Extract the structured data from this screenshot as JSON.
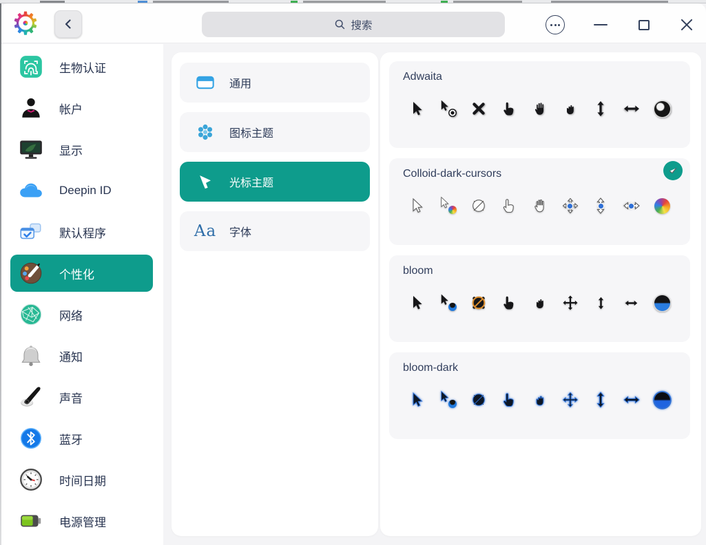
{
  "colors": {
    "accent_teal": "#0e9c8c",
    "title_text": "#313e5c",
    "card_bg": "#f6f6f8",
    "selected_text": "#ffffff"
  },
  "titlebar": {
    "search": {
      "placeholder": "搜索"
    },
    "icons": {
      "logo": "settings-gear",
      "back": "chevron-left",
      "menu": "more-options-dots",
      "minimize": "minimize",
      "maximize": "maximize",
      "close": "close"
    }
  },
  "sidebar": {
    "items": [
      {
        "label": "生物认证",
        "icon": "fingerprint",
        "selected": false
      },
      {
        "label": "帐户",
        "icon": "user-account",
        "selected": false
      },
      {
        "label": "显示",
        "icon": "display-monitor",
        "selected": false
      },
      {
        "label": "Deepin ID",
        "icon": "cloud",
        "selected": false
      },
      {
        "label": "默认程序",
        "icon": "default-apps",
        "selected": false
      },
      {
        "label": "个性化",
        "icon": "personalization-palette",
        "selected": true
      },
      {
        "label": "网络",
        "icon": "network-globe",
        "selected": false
      },
      {
        "label": "通知",
        "icon": "notification-bell",
        "selected": false
      },
      {
        "label": "声音",
        "icon": "sound-speaker",
        "selected": false
      },
      {
        "label": "蓝牙",
        "icon": "bluetooth",
        "selected": false
      },
      {
        "label": "时间日期",
        "icon": "clock",
        "selected": false
      },
      {
        "label": "电源管理",
        "icon": "battery",
        "selected": false
      }
    ]
  },
  "nav": {
    "items": [
      {
        "label": "通用",
        "icon": "general-window",
        "selected": false
      },
      {
        "label": "图标主题",
        "icon": "icon-theme-flower",
        "selected": false
      },
      {
        "label": "光标主题",
        "icon": "cursor-arrow",
        "selected": true
      },
      {
        "label": "字体",
        "icon": "font-sample",
        "selected": false
      }
    ],
    "font_sample": "Aa"
  },
  "cursor_themes": {
    "cards": [
      {
        "name": "Adwaita",
        "selected": false,
        "cursors": [
          "default-arrow",
          "working-arrow",
          "cross",
          "hand-pointing",
          "hand-open",
          "hand-grab",
          "resize-vertical",
          "resize-horizontal",
          "wait-disc"
        ]
      },
      {
        "name": "Colloid-dark-cursors",
        "selected": true,
        "cursors": [
          "default-arrow",
          "working-arrow",
          "unavailable",
          "hand-pointing",
          "hand-open",
          "move-cross",
          "resize-vertical",
          "resize-horizontal",
          "wait-rainbow"
        ]
      },
      {
        "name": "bloom",
        "selected": false,
        "cursors": [
          "default-arrow",
          "working-arrow",
          "unavailable",
          "hand-pointing",
          "hand-grab",
          "move-cross",
          "resize-vertical",
          "resize-horizontal",
          "wait-disc"
        ]
      },
      {
        "name": "bloom-dark",
        "selected": false,
        "cursors": [
          "default-arrow",
          "working-arrow",
          "unavailable",
          "hand-pointing",
          "hand-grab",
          "move-cross",
          "resize-vertical",
          "resize-horizontal",
          "wait-disc"
        ]
      }
    ]
  }
}
